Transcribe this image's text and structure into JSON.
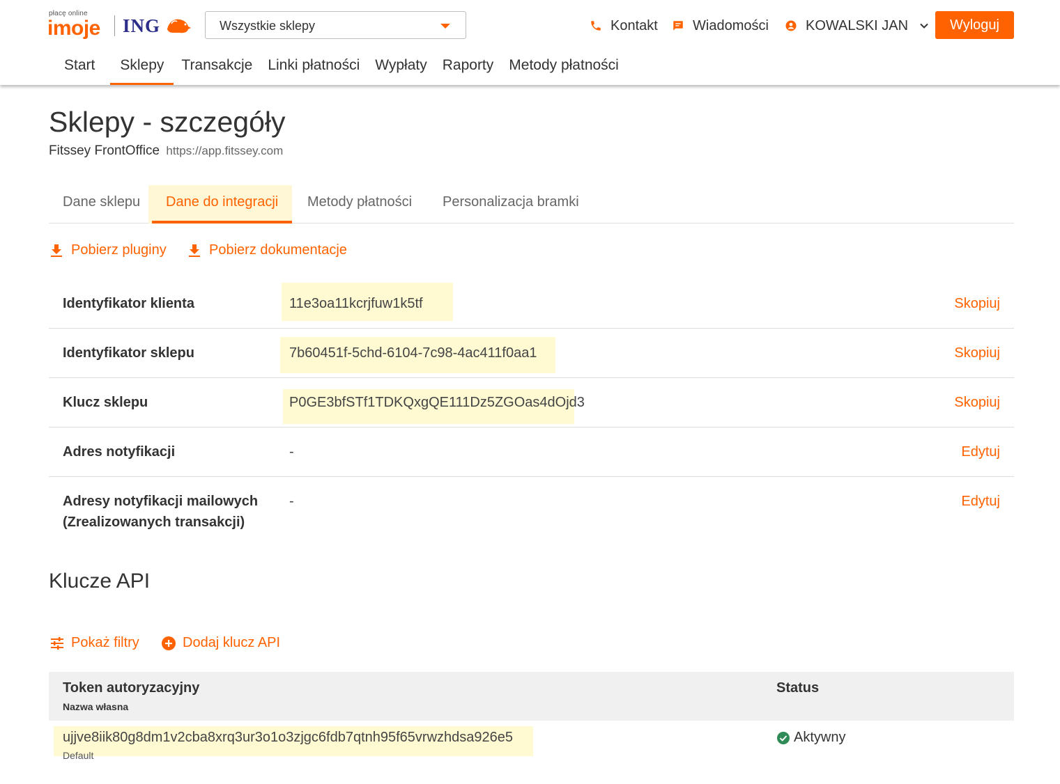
{
  "logo": {
    "tagline": "płacę online",
    "brand": "imoje",
    "bank": "ING"
  },
  "store_select": {
    "value": "Wszystkie sklepy"
  },
  "header_links": {
    "contact": "Kontakt",
    "messages": "Wiadomości",
    "user": "KOWALSKI JAN",
    "logout": "Wyloguj"
  },
  "main_nav": {
    "items": [
      "Start",
      "Sklepy",
      "Transakcje",
      "Linki płatności",
      "Wypłaty",
      "Raporty",
      "Metody płatności"
    ],
    "active": "Sklepy"
  },
  "page": {
    "title": "Sklepy - szczegóły",
    "store_name": "Fitssey FrontOffice",
    "store_url": "https://app.fitssey.com"
  },
  "tabs": {
    "items": [
      "Dane sklepu",
      "Dane do integracji",
      "Metody płatności",
      "Personalizacja bramki"
    ],
    "active": "Dane do integracji"
  },
  "downloads": {
    "plugins": "Pobierz pluginy",
    "docs": "Pobierz dokumentacje"
  },
  "info_rows": [
    {
      "label": "Identyfikator klienta",
      "value": "11e3oa11kcrjfuw1k5tf",
      "action": "Skopiuj"
    },
    {
      "label": "Identyfikator sklepu",
      "value": "7b60451f-5chd-6104-7c98-4ac411f0aa1",
      "action": "Skopiuj"
    },
    {
      "label": "Klucz sklepu",
      "value": "P0GE3bfSTf1TDKQxgQE111Dz5ZGOas4dOjd3",
      "action": "Skopiuj"
    },
    {
      "label": "Adres notyfikacji",
      "value": "-",
      "action": "Edytuj"
    },
    {
      "label_line1": "Adresy notyfikacji mailowych",
      "label_line2": "(Zrealizowanych transakcji)",
      "value": "-",
      "action": "Edytuj"
    }
  ],
  "api": {
    "title": "Klucze API",
    "show_filters": "Pokaż filtry",
    "add_key": "Dodaj klucz API",
    "columns": {
      "token": "Token autoryzacyjny",
      "token_sub": "Nazwa własna",
      "status": "Status"
    },
    "rows": [
      {
        "token": "ujjve8iik80g8dm1v2cba8xrq3ur3o1o3zjgc6fdb7qtnh95f65vrwzhdsa926e5",
        "name": "Default",
        "status": "Aktywny"
      }
    ]
  },
  "colors": {
    "accent": "#ff6200",
    "highlight": "#fffad2",
    "status_ok": "#2e8b57"
  }
}
